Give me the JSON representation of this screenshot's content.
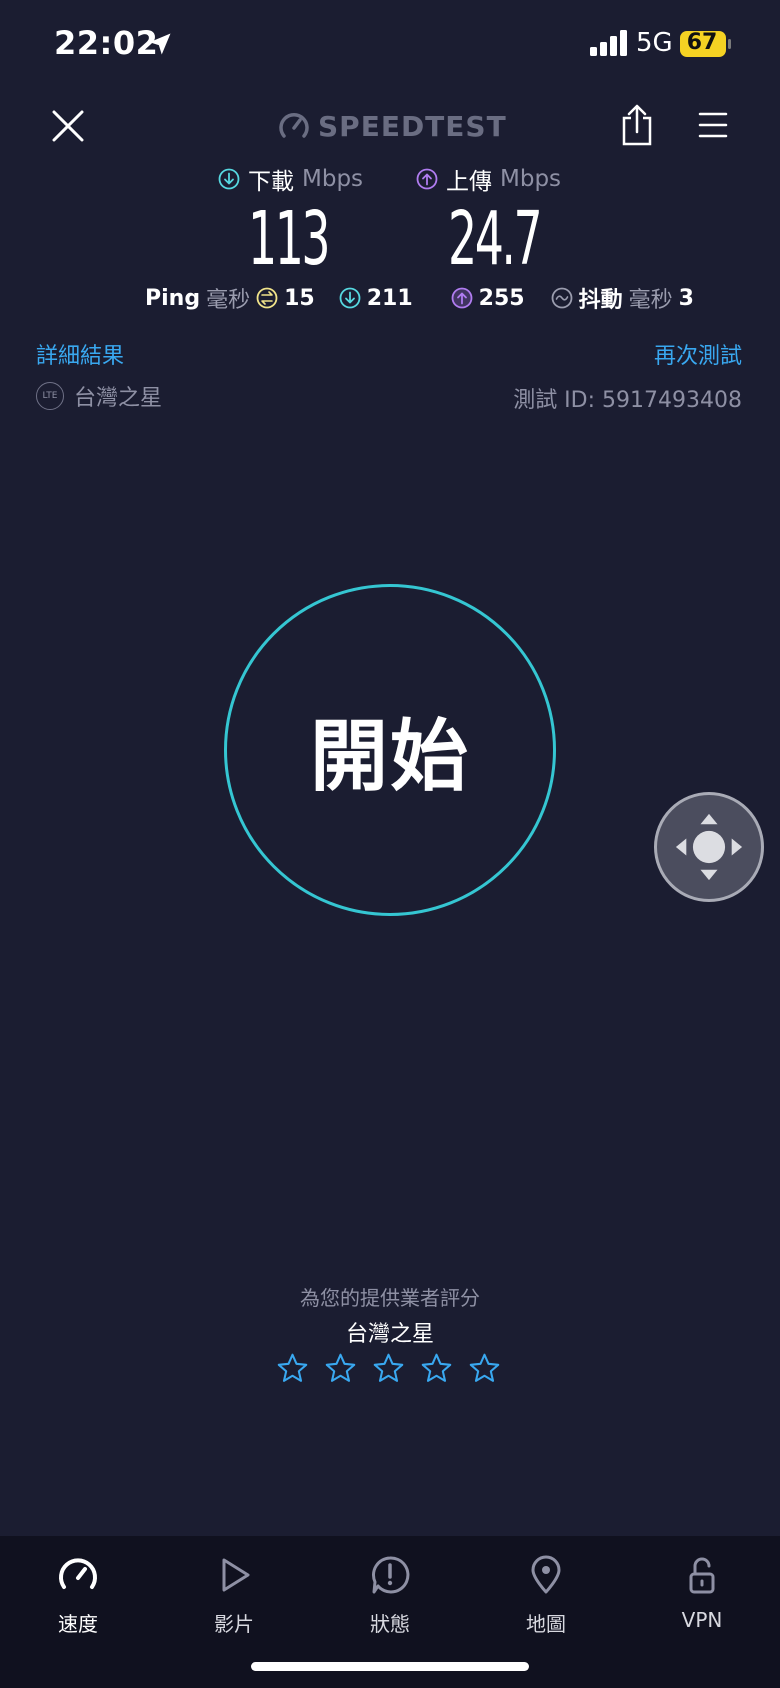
{
  "status_bar": {
    "time": "22:02",
    "network": "5G",
    "battery": "67"
  },
  "header": {
    "logo_text": "SPEEDTEST"
  },
  "results": {
    "download_label": "下載",
    "upload_label": "上傳",
    "unit": "Mbps",
    "download_value": "113",
    "upload_value": "24.7",
    "ping_label": "Ping",
    "ping_unit": "毫秒",
    "ping_idle": "15",
    "ping_download": "211",
    "ping_upload": "255",
    "jitter_label": "抖動",
    "jitter_unit": "毫秒",
    "jitter_value": "3"
  },
  "links": {
    "detail": "詳細結果",
    "retest": "再次測試"
  },
  "provider": {
    "badge": "LTE",
    "name": "台灣之星",
    "test_id": "測試 ID: 5917493408"
  },
  "start_button": {
    "label": "開始"
  },
  "rating": {
    "prompt": "為您的提供業者評分",
    "provider": "台灣之星",
    "stars_total": 5,
    "stars_filled": 0
  },
  "nav": [
    {
      "label": "速度",
      "icon": "speedometer-icon",
      "active": true
    },
    {
      "label": "影片",
      "icon": "play-icon",
      "active": false
    },
    {
      "label": "狀態",
      "icon": "alert-icon",
      "active": false
    },
    {
      "label": "地圖",
      "icon": "map-pin-icon",
      "active": false
    },
    {
      "label": "VPN",
      "icon": "unlock-icon",
      "active": false
    }
  ],
  "colors": {
    "accent": "#39a8f0",
    "ring": "#35c6d2",
    "download": "#56d8e0",
    "upload": "#b07cf0",
    "idle": "#f1e48a",
    "battery": "#f5d223"
  }
}
